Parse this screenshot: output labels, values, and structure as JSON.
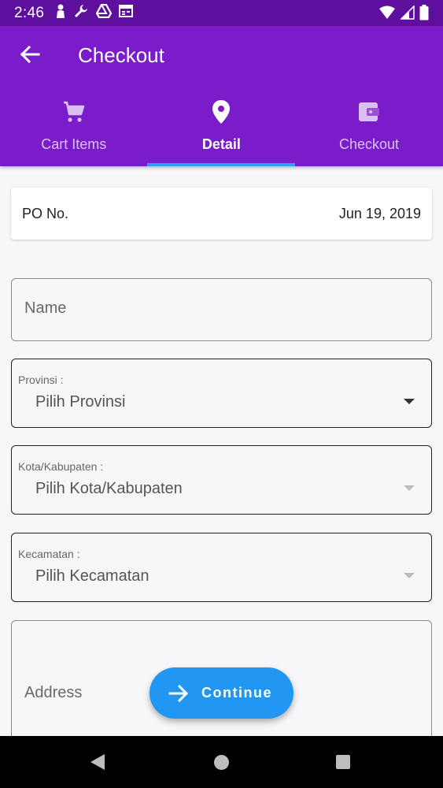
{
  "status_bar": {
    "time": "2:46",
    "icons_left": [
      "person-icon",
      "wrench-icon",
      "drive-icon",
      "calendar-icon"
    ],
    "icons_right": [
      "wifi-icon",
      "signal-icon",
      "battery-icon"
    ]
  },
  "app_bar": {
    "title": "Checkout",
    "back_icon": "arrow-left-icon"
  },
  "tabs": [
    {
      "label": "Cart Items",
      "icon": "cart-icon",
      "active": false
    },
    {
      "label": "Detail",
      "icon": "location-pin-icon",
      "active": true
    },
    {
      "label": "Checkout",
      "icon": "wallet-icon",
      "active": false
    }
  ],
  "po_card": {
    "label": "PO No.",
    "date": "Jun 19, 2019"
  },
  "form": {
    "name": {
      "placeholder": "Name",
      "value": ""
    },
    "provinsi": {
      "label": "Provinsi :",
      "value": "Pilih Provinsi",
      "enabled": true
    },
    "kota": {
      "label": "Kota/Kabupaten :",
      "value": "Pilih Kota/Kabupaten",
      "enabled": false
    },
    "kecamatan": {
      "label": "Kecamatan :",
      "value": "Pilih Kecamatan",
      "enabled": false
    },
    "address": {
      "placeholder": "Address"
    }
  },
  "fab": {
    "label": "Continue",
    "icon": "arrow-right-icon"
  },
  "colors": {
    "status_bar": "#5f0f9e",
    "app_bar": "#7a1cc9",
    "tab_indicator": "#2fa0ee",
    "fab": "#2196f3"
  }
}
